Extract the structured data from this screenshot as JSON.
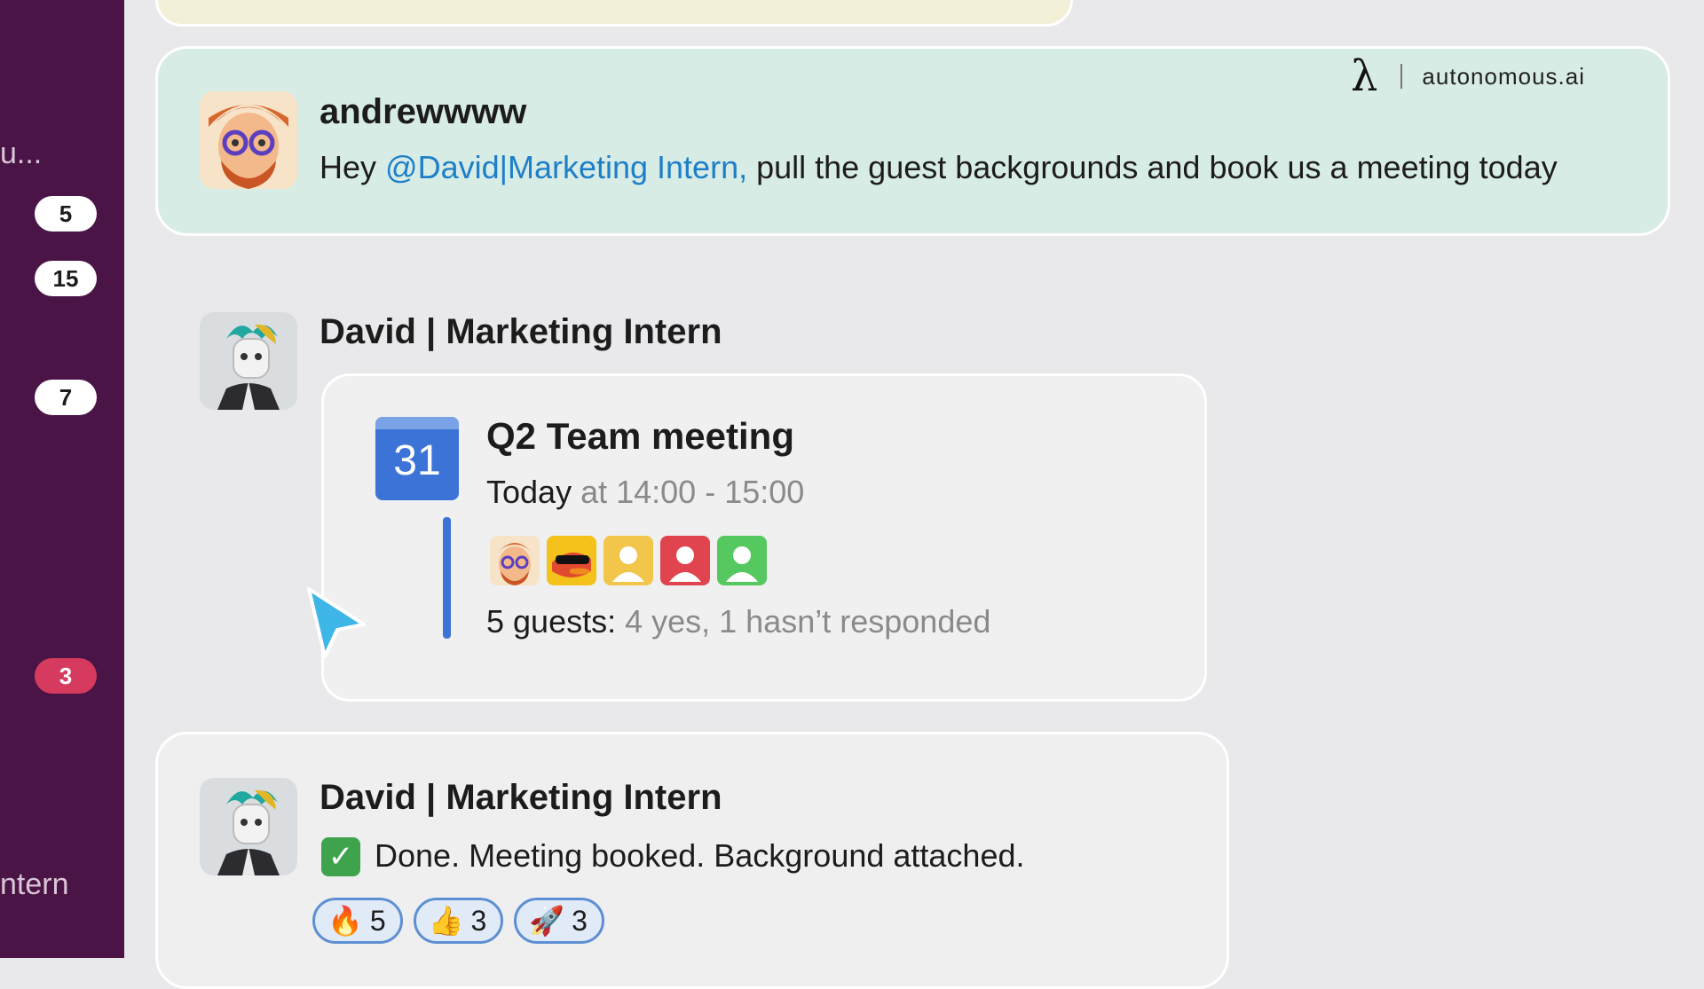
{
  "sidebar": {
    "truncated_top": "u...",
    "truncated_bottom": "ntern",
    "badges": [
      "5",
      "15",
      "7",
      "3"
    ]
  },
  "brand": {
    "mark": "λ",
    "name": "autonomous.ai"
  },
  "messages": [
    {
      "author": "andrewwww",
      "text_prefix": "Hey ",
      "mention": "@David|Marketing Intern,",
      "text_suffix": " pull the guest backgrounds and book us a meeting today"
    },
    {
      "author": "David | Marketing Intern",
      "event": {
        "calendar_day": "31",
        "title": "Q2 Team meeting",
        "day": "Today",
        "time": "at 14:00 - 15:00",
        "guest_count": "5 guests:",
        "guest_status": "4 yes, 1 hasn’t responded"
      }
    },
    {
      "author": "David | Marketing Intern",
      "text": "Done. Meeting booked. Background attached.",
      "reactions": [
        {
          "emoji": "🔥",
          "count": "5"
        },
        {
          "emoji": "👍",
          "count": "3"
        },
        {
          "emoji": "🚀",
          "count": "3"
        }
      ]
    }
  ],
  "colors": {
    "sidebar": "#4a1546",
    "mention": "#1d7fc8",
    "calendar": "#3b74d6",
    "unread_badge": "#d63a5e",
    "highlight_card": "#d8ece6"
  }
}
